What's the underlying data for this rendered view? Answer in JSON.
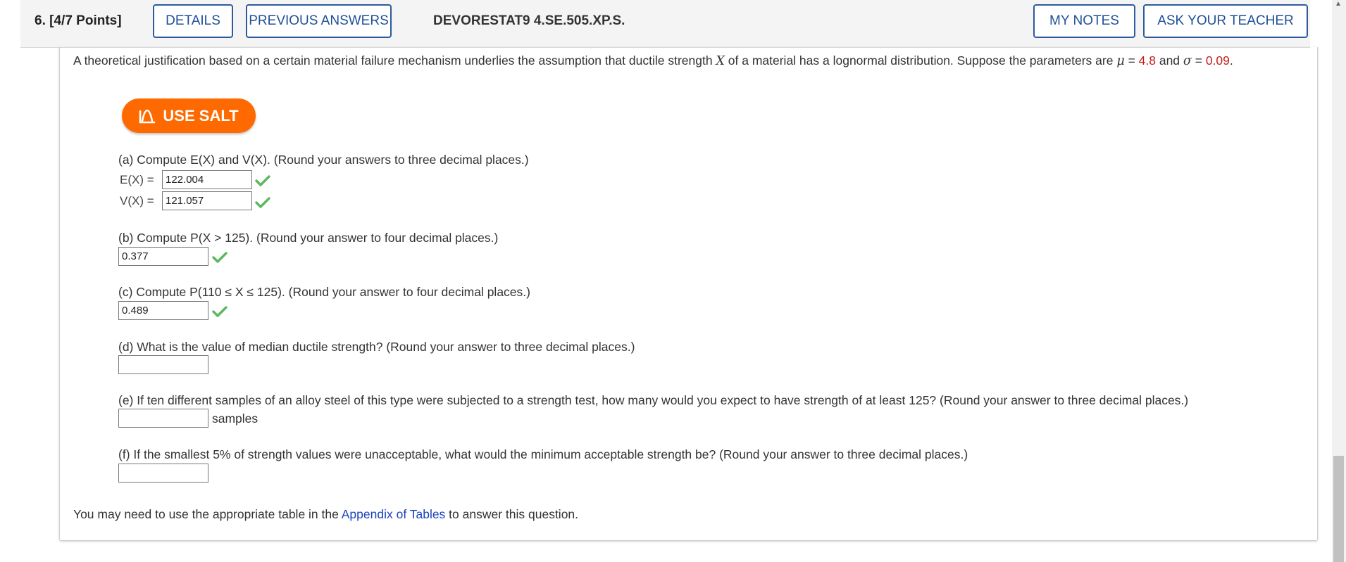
{
  "header": {
    "question_number": "6.",
    "points": "[4/7 Points]",
    "details_label": "DETAILS",
    "previous_answers_label": "PREVIOUS ANSWERS",
    "question_code": "DEVORESTAT9 4.SE.505.XP.S.",
    "my_notes_label": "MY NOTES",
    "ask_teacher_label": "ASK YOUR TEACHER"
  },
  "intro": {
    "text_before": "A theoretical justification based on a certain material failure mechanism underlies the assumption that ductile strength ",
    "var_x": "X",
    "text_middle": " of a material has a lognormal distribution. Suppose the parameters are ",
    "mu_symbol": "μ",
    "equals": " = ",
    "mu_value": "4.8",
    "and": " and ",
    "sigma_symbol": "σ",
    "sigma_value": "0.09",
    "period": "."
  },
  "salt_button": {
    "label": "USE SALT",
    "icon": "salt-icon"
  },
  "parts": {
    "a": {
      "prompt": "(a) Compute E(X) and V(X). (Round your answers to three decimal places.)",
      "ex_label": "E(X) =",
      "ex_value": "122.004",
      "vx_label": "V(X) =",
      "vx_value": "121.057"
    },
    "b": {
      "prompt": "(b) Compute P(X > 125). (Round your answer to four decimal places.)",
      "value": "0.377"
    },
    "c": {
      "prompt": "(c) Compute P(110 ≤ X ≤ 125). (Round your answer to four decimal places.)",
      "value": "0.489"
    },
    "d": {
      "prompt": "(d) What is the value of median ductile strength? (Round your answer to three decimal places.)",
      "value": ""
    },
    "e": {
      "prompt": "(e) If ten different samples of an alloy steel of this type were subjected to a strength test, how many would you expect to have strength of at least 125? (Round your answer to three decimal places.)",
      "value": "",
      "units": "samples"
    },
    "f": {
      "prompt": "(f) If the smallest 5% of strength values were unacceptable, what would the minimum acceptable strength be? (Round your answer to three decimal places.)",
      "value": ""
    }
  },
  "footer": {
    "before": "You may need to use the appropriate table in the ",
    "link": "Appendix of Tables",
    "after": " to answer this question."
  },
  "colors": {
    "accent": "#1f4f97",
    "salt": "#ff6a00",
    "correct": "#5cb85c",
    "highlight": "#c41c1c"
  }
}
